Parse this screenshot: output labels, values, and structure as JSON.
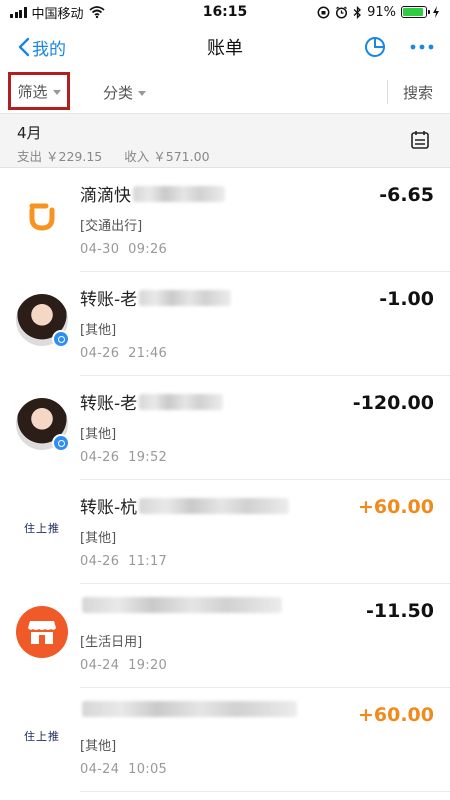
{
  "status_bar": {
    "carrier": "中国移动",
    "time": "16:15",
    "battery": "91%",
    "battery_level": 0.91
  },
  "nav": {
    "back_label": "我的",
    "title": "账单",
    "icons": [
      "chart-pie-icon",
      "more-icon"
    ]
  },
  "filter_bar": {
    "filter_label": "筛选",
    "category_label": "分类",
    "search_label": "搜索"
  },
  "month": {
    "title": "4月",
    "expense_label": "支出",
    "expense": "￥229.15",
    "income_label": "收入",
    "income": "￥571.00"
  },
  "transactions": [
    {
      "icon": "didi-logo",
      "name": "滴滴快",
      "category": "[交通出行]",
      "date": "04-30",
      "time": "09:26",
      "amount": "-6.65",
      "type": "expense"
    },
    {
      "icon": "avatar-person",
      "name": "转账-老",
      "category": "[其他]",
      "date": "04-26",
      "time": "21:46",
      "amount": "-1.00",
      "type": "expense"
    },
    {
      "icon": "avatar-person",
      "name": "转账-老",
      "category": "[其他]",
      "date": "04-26",
      "time": "19:52",
      "amount": "-120.00",
      "type": "expense"
    },
    {
      "icon": "brand-logo",
      "name": "转账-杭",
      "category": "[其他]",
      "date": "04-26",
      "time": "11:17",
      "amount": "+60.00",
      "type": "income"
    },
    {
      "icon": "shop-icon",
      "name": "",
      "category": "[生活日用]",
      "date": "04-24",
      "time": "19:20",
      "amount": "-11.50",
      "type": "expense"
    },
    {
      "icon": "brand-logo",
      "name": "",
      "category": "[其他]",
      "date": "04-24",
      "time": "10:05",
      "amount": "+60.00",
      "type": "income"
    }
  ],
  "brand_logo_text": "住上推",
  "colors": {
    "accent": "#1a87e0",
    "income": "#f08a1c",
    "highlight_box": "#b0201e",
    "didi_orange": "#f7931e",
    "shop_orange": "#f05a28"
  }
}
